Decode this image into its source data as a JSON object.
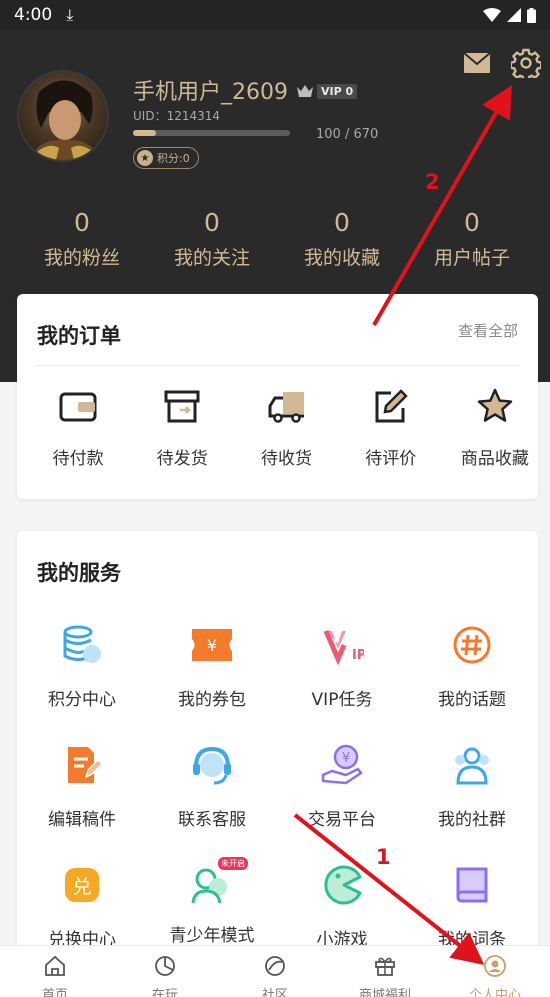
{
  "status_bar": {
    "time": "4:00"
  },
  "profile": {
    "username": "手机用户_2609",
    "vip": "VIP 0",
    "uid": "UID：1214314",
    "progress_text": "100 / 670",
    "progress_fraction": 0.149,
    "points": "积分:0"
  },
  "stats": [
    {
      "num": "0",
      "label": "我的粉丝"
    },
    {
      "num": "0",
      "label": "我的关注"
    },
    {
      "num": "0",
      "label": "我的收藏"
    },
    {
      "num": "0",
      "label": "用户帖子"
    }
  ],
  "orders": {
    "title": "我的订单",
    "view_all": "查看全部",
    "items": [
      {
        "label": "待付款",
        "icon": "wallet-icon"
      },
      {
        "label": "待发货",
        "icon": "box-icon"
      },
      {
        "label": "待收货",
        "icon": "truck-icon"
      },
      {
        "label": "待评价",
        "icon": "edit-icon"
      },
      {
        "label": "商品收藏",
        "icon": "star-icon"
      }
    ]
  },
  "services": {
    "title": "我的服务",
    "items": [
      {
        "label": "积分中心",
        "icon": "coins-icon"
      },
      {
        "label": "我的券包",
        "icon": "coupon-icon"
      },
      {
        "label": "VIP任务",
        "icon": "vip-icon"
      },
      {
        "label": "我的话题",
        "icon": "hashtag-icon"
      },
      {
        "label": "编辑稿件",
        "icon": "document-edit-icon"
      },
      {
        "label": "联系客服",
        "icon": "headset-icon"
      },
      {
        "label": "交易平台",
        "icon": "trade-icon"
      },
      {
        "label": "我的社群",
        "icon": "group-icon"
      },
      {
        "label": "兑换中心",
        "icon": "exchange-icon"
      },
      {
        "label": "青少年模式",
        "icon": "teen-icon",
        "tag": "未开启"
      },
      {
        "label": "小游戏",
        "icon": "game-icon"
      },
      {
        "label": "我的词条",
        "icon": "book-icon"
      }
    ]
  },
  "tabbar": [
    {
      "label": "首页",
      "icon": "home-icon"
    },
    {
      "label": "在玩",
      "icon": "playing-icon"
    },
    {
      "label": "社区",
      "icon": "community-icon"
    },
    {
      "label": "商城福利",
      "icon": "gift-icon"
    },
    {
      "label": "个人中心",
      "icon": "user-icon",
      "active": true
    }
  ],
  "annotations": {
    "arrow1": "1",
    "arrow2": "2",
    "color": "#e0121b"
  },
  "colors": {
    "accent": "#d2b894",
    "header_bg": "#2a2a2a",
    "active_tab": "#c9a06a"
  }
}
